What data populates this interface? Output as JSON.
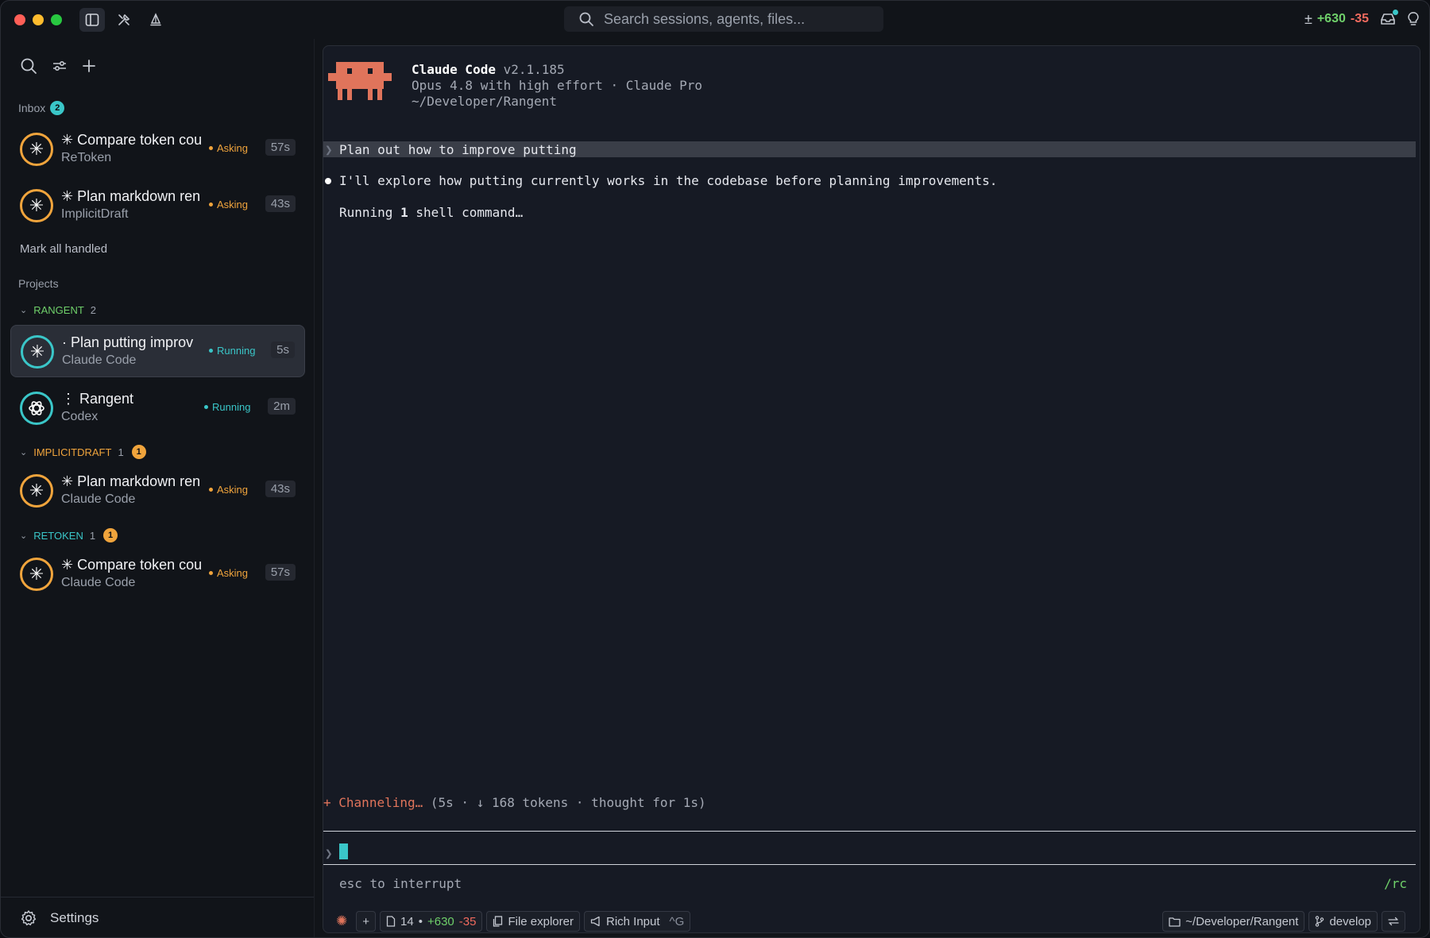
{
  "titlebar": {
    "search_placeholder": "Search sessions, agents, files...",
    "diff_plus": "+630",
    "diff_minus": "-35"
  },
  "sidebar": {
    "inbox_label": "Inbox",
    "inbox_count": "2",
    "inbox_items": [
      {
        "title": "✳ Compare token cou",
        "subtitle": "ReToken",
        "status": "Asking",
        "time": "57s"
      },
      {
        "title": "✳ Plan markdown ren",
        "subtitle": "ImplicitDraft",
        "status": "Asking",
        "time": "43s"
      }
    ],
    "mark_all_handled": "Mark all handled",
    "projects_label": "Projects",
    "groups": [
      {
        "name": "RANGENT",
        "count": "2",
        "badge": "",
        "sessions": [
          {
            "title": "· Plan putting improv",
            "subtitle": "Claude Code",
            "status": "Running",
            "time": "5s"
          },
          {
            "title": "⋮ Rangent",
            "subtitle": "Codex",
            "status": "Running",
            "time": "2m"
          }
        ]
      },
      {
        "name": "IMPLICITDRAFT",
        "count": "1",
        "badge": "1",
        "sessions": [
          {
            "title": "✳ Plan markdown ren",
            "subtitle": "Claude Code",
            "status": "Asking",
            "time": "43s"
          }
        ]
      },
      {
        "name": "RETOKEN",
        "count": "1",
        "badge": "1",
        "sessions": [
          {
            "title": "✳ Compare token cou",
            "subtitle": "Claude Code",
            "status": "Asking",
            "time": "57s"
          }
        ]
      }
    ],
    "settings_label": "Settings"
  },
  "terminal": {
    "app_name": "Claude Code",
    "version": "v2.1.185",
    "model_line": "Opus 4.8 with high effort · Claude Pro",
    "cwd": "~/Developer/Rangent",
    "prompt": "Plan out how to improve putting",
    "response": "I'll explore how putting currently works in the codebase before planning improvements.",
    "running_prefix": "Running ",
    "running_count": "1",
    "running_suffix": " shell command…",
    "channel_symbol": "+",
    "channel_word": "Channeling…",
    "channel_meta": "(5s · ↓ 168 tokens · thought for 1s)",
    "esc_hint": "esc to interrupt",
    "rc": "/rc"
  },
  "statusbar": {
    "files_count": "14",
    "files_plus": "+630",
    "files_minus": "-35",
    "file_explorer": "File explorer",
    "rich_input": "Rich Input",
    "rich_input_shortcut": "^G",
    "path": "~/Developer/Rangent",
    "branch": "develop"
  },
  "colors": {
    "accent_teal": "#3ac6c8",
    "asking_orange": "#f0a43c",
    "added_green": "#6fd06a",
    "removed_red": "#ef6a5e",
    "mascot": "#e0745b"
  }
}
